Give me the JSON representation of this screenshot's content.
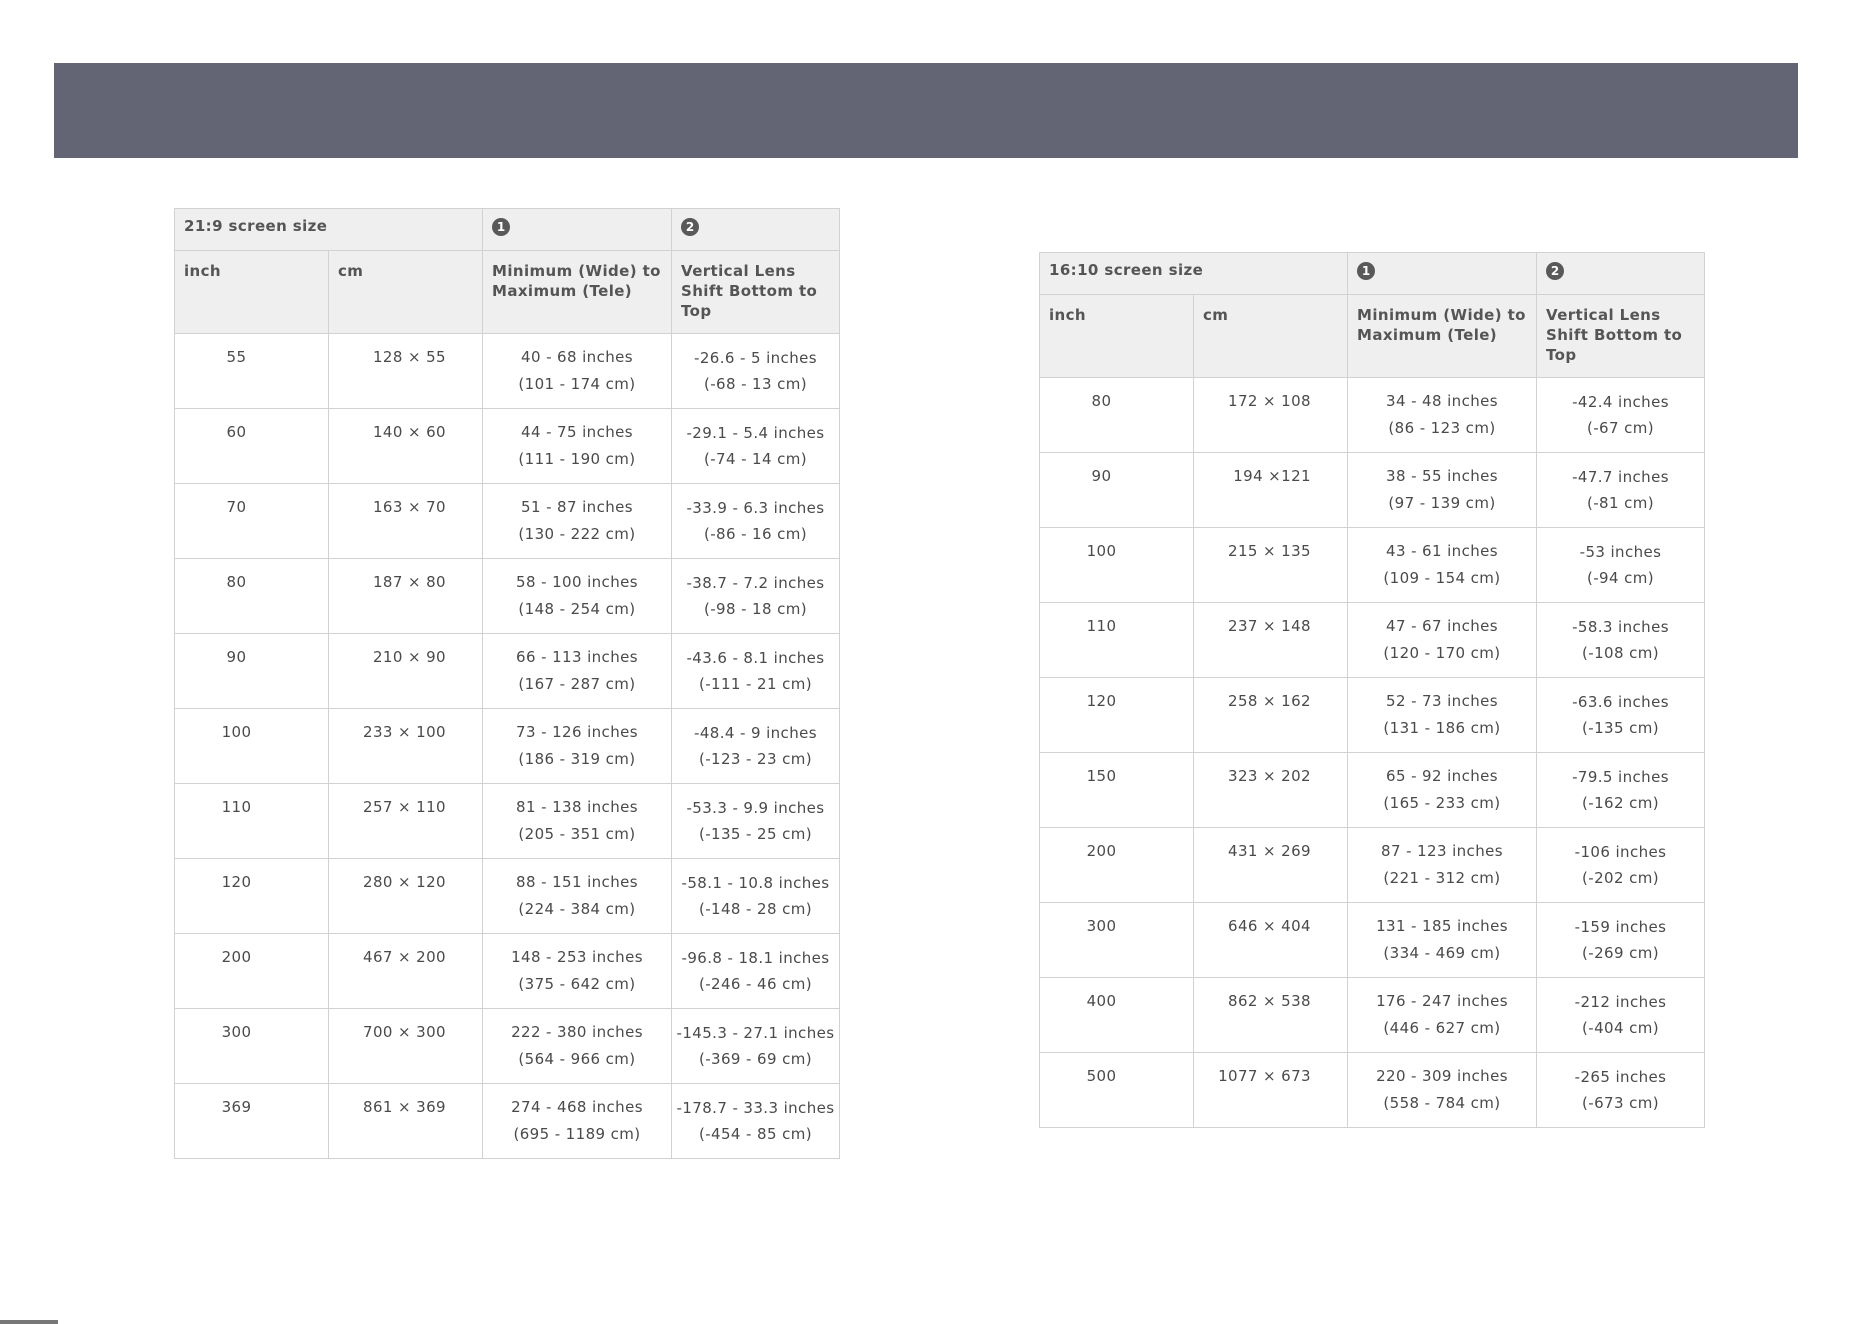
{
  "left_table": {
    "title": "21:9 screen size",
    "marker1": "1",
    "marker2": "2",
    "headers": {
      "inch": "inch",
      "cm": "cm",
      "distance": "Minimum (Wide) to Maximum (Tele)",
      "shift": "Vertical Lens Shift Bottom to Top"
    },
    "rows": [
      {
        "inch": "55",
        "cm": "128 × 55",
        "dist_in": "40 - 68 inches",
        "dist_cm": "(101 - 174 cm)",
        "shift_in": "-26.6 - 5 inches",
        "shift_cm": "(-68 - 13 cm)"
      },
      {
        "inch": "60",
        "cm": "140 × 60",
        "dist_in": "44 - 75 inches",
        "dist_cm": "(111 - 190 cm)",
        "shift_in": "-29.1 - 5.4 inches",
        "shift_cm": "(-74 - 14 cm)"
      },
      {
        "inch": "70",
        "cm": "163 × 70",
        "dist_in": "51 - 87 inches",
        "dist_cm": "(130 - 222 cm)",
        "shift_in": "-33.9 - 6.3 inches",
        "shift_cm": "(-86 - 16 cm)"
      },
      {
        "inch": "80",
        "cm": "187 × 80",
        "dist_in": "58 - 100 inches",
        "dist_cm": "(148 - 254 cm)",
        "shift_in": "-38.7 - 7.2 inches",
        "shift_cm": "(-98 - 18 cm)"
      },
      {
        "inch": "90",
        "cm": "210 × 90",
        "dist_in": "66 - 113 inches",
        "dist_cm": "(167 - 287 cm)",
        "shift_in": "-43.6 - 8.1 inches",
        "shift_cm": "(-111 - 21 cm)"
      },
      {
        "inch": "100",
        "cm": "233 × 100",
        "dist_in": "73 - 126 inches",
        "dist_cm": "(186 - 319 cm)",
        "shift_in": "-48.4 - 9 inches",
        "shift_cm": "(-123 - 23 cm)"
      },
      {
        "inch": "110",
        "cm": "257 × 110",
        "dist_in": "81 - 138 inches",
        "dist_cm": "(205 - 351 cm)",
        "shift_in": "-53.3 - 9.9 inches",
        "shift_cm": "(-135 - 25 cm)"
      },
      {
        "inch": "120",
        "cm": "280 × 120",
        "dist_in": "88 - 151 inches",
        "dist_cm": "(224 - 384 cm)",
        "shift_in": "-58.1 - 10.8 inches",
        "shift_cm": "(-148 - 28 cm)"
      },
      {
        "inch": "200",
        "cm": "467 × 200",
        "dist_in": "148 - 253 inches",
        "dist_cm": "(375 - 642 cm)",
        "shift_in": "-96.8 - 18.1 inches",
        "shift_cm": "(-246 - 46 cm)"
      },
      {
        "inch": "300",
        "cm": "700 × 300",
        "dist_in": "222 - 380 inches",
        "dist_cm": "(564 - 966 cm)",
        "shift_in": "-145.3 - 27.1 inches",
        "shift_cm": "(-369 - 69 cm)"
      },
      {
        "inch": "369",
        "cm": "861 × 369",
        "dist_in": "274 - 468 inches",
        "dist_cm": "(695 - 1189 cm)",
        "shift_in": "-178.7 - 33.3 inches",
        "shift_cm": "(-454 - 85 cm)"
      }
    ]
  },
  "right_table": {
    "title": "16:10 screen size",
    "marker1": "1",
    "marker2": "2",
    "headers": {
      "inch": "inch",
      "cm": "cm",
      "distance": "Minimum (Wide) to Maximum (Tele)",
      "shift": "Vertical Lens Shift Bottom to Top"
    },
    "rows": [
      {
        "inch": "80",
        "cm": "172 × 108",
        "dist_in": "34 - 48 inches",
        "dist_cm": "(86 - 123 cm)",
        "shift_in": "-42.4 inches",
        "shift_cm": "(-67 cm)"
      },
      {
        "inch": "90",
        "cm": "194 ×121",
        "dist_in": "38 - 55 inches",
        "dist_cm": "(97 - 139 cm)",
        "shift_in": "-47.7 inches",
        "shift_cm": "(-81 cm)"
      },
      {
        "inch": "100",
        "cm": "215 × 135",
        "dist_in": "43 - 61 inches",
        "dist_cm": "(109 - 154 cm)",
        "shift_in": "-53 inches",
        "shift_cm": "(-94 cm)"
      },
      {
        "inch": "110",
        "cm": "237 × 148",
        "dist_in": "47 - 67 inches",
        "dist_cm": "(120 - 170 cm)",
        "shift_in": "-58.3 inches",
        "shift_cm": "(-108 cm)"
      },
      {
        "inch": "120",
        "cm": "258 × 162",
        "dist_in": "52 - 73 inches",
        "dist_cm": "(131 - 186 cm)",
        "shift_in": "-63.6 inches",
        "shift_cm": "(-135 cm)"
      },
      {
        "inch": "150",
        "cm": "323 × 202",
        "dist_in": "65 - 92 inches",
        "dist_cm": "(165 - 233 cm)",
        "shift_in": "-79.5 inches",
        "shift_cm": "(-162 cm)"
      },
      {
        "inch": "200",
        "cm": "431 × 269",
        "dist_in": "87 - 123 inches",
        "dist_cm": "(221 - 312 cm)",
        "shift_in": "-106 inches",
        "shift_cm": "(-202 cm)"
      },
      {
        "inch": "300",
        "cm": "646 × 404",
        "dist_in": "131 - 185 inches",
        "dist_cm": "(334 - 469 cm)",
        "shift_in": "-159 inches",
        "shift_cm": "(-269 cm)"
      },
      {
        "inch": "400",
        "cm": "862 × 538",
        "dist_in": "176 - 247 inches",
        "dist_cm": "(446 - 627 cm)",
        "shift_in": "-212 inches",
        "shift_cm": "(-404 cm)"
      },
      {
        "inch": "500",
        "cm": "1077 × 673",
        "dist_in": "220 - 309 inches",
        "dist_cm": "(558 - 784 cm)",
        "shift_in": "-265 inches",
        "shift_cm": "(-673 cm)"
      }
    ]
  }
}
